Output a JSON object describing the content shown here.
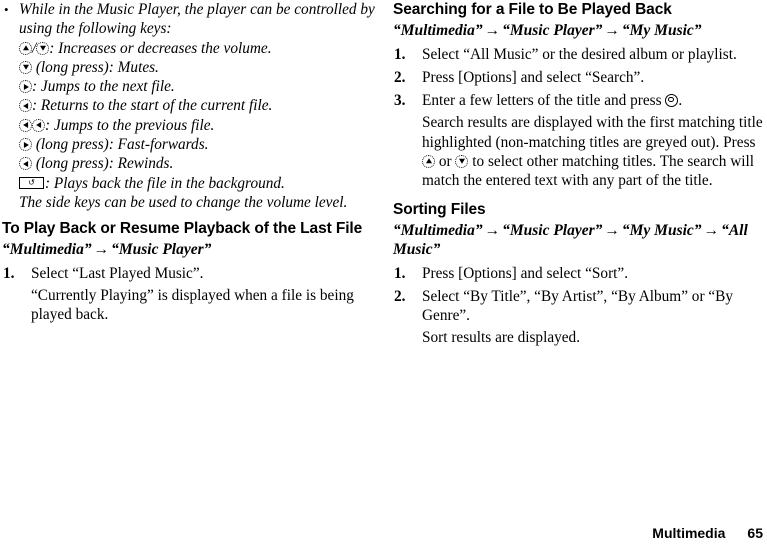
{
  "document": {
    "footer": {
      "section": "Multimedia",
      "page_number": "65"
    }
  },
  "left_column": {
    "bullet": {
      "marker": "•",
      "lead_text": "While in the Music Player, the player can be controlled by using the following keys:",
      "key_lines": [
        {
          "icons": [
            "nav-up-key",
            "slash",
            "nav-down-key"
          ],
          "text": ": Increases or decreases the volume."
        },
        {
          "icons": [
            "nav-down-key"
          ],
          "text": " (long press): Mutes."
        },
        {
          "icons": [
            "nav-right-key"
          ],
          "text": ": Jumps to the next file."
        },
        {
          "icons": [
            "nav-left-key"
          ],
          "text": ": Returns to the start of the current file."
        },
        {
          "icons": [
            "nav-left-key",
            "nav-left-key"
          ],
          "text": ": Jumps to the previous file."
        },
        {
          "icons": [
            "nav-right-key"
          ],
          "text": " (long press): Fast-forwards."
        },
        {
          "icons": [
            "nav-left-key"
          ],
          "text": " (long press): Rewinds."
        },
        {
          "icons": [
            "soft-key"
          ],
          "text": ": Plays back the file in the background."
        }
      ],
      "closing_text": "The side keys can be used to change the volume level."
    },
    "section": {
      "heading": "To Play Back or Resume Playback of the Last File",
      "path": [
        "“Multimedia”",
        "“Music Player”"
      ],
      "steps": [
        {
          "num": "1.",
          "text": "Select “Last Played Music”."
        }
      ],
      "note": "“Currently Playing” is displayed when a file is being played back."
    }
  },
  "right_column": {
    "search_section": {
      "heading": "Searching for a File to Be Played Back",
      "path": [
        "“Multimedia”",
        "“Music Player”",
        "“My Music”"
      ],
      "steps": [
        {
          "num": "1.",
          "text": "Select “All Music” or the desired album or playlist."
        },
        {
          "num": "2.",
          "text": "Press [Options] and select “Search”."
        },
        {
          "num": "3.",
          "text_before": "Enter a few letters of the title and press ",
          "icon": "center-select-key",
          "text_after": "."
        }
      ],
      "note_part1": "Search results are displayed with the first matching title highlighted (non-matching titles are greyed out). Press ",
      "note_icon1": "nav-up-key",
      "note_part2": " or ",
      "note_icon2": "nav-down-key",
      "note_part3": " to select other matching titles. The search will match the entered text with any part of the title."
    },
    "sorting_section": {
      "heading": "Sorting Files",
      "path": [
        "“Multimedia”",
        "“Music Player”",
        "“My Music”",
        "“All Music”"
      ],
      "steps": [
        {
          "num": "1.",
          "text": "Press [Options] and select “Sort”."
        },
        {
          "num": "2.",
          "text": "Select “By Title”, “By Artist”, “By Album” or “By Genre”."
        }
      ],
      "note": "Sort results are displayed."
    }
  },
  "symbols": {
    "arrow": "→",
    "slash": "/",
    "soft_key_glyph": "↺"
  }
}
